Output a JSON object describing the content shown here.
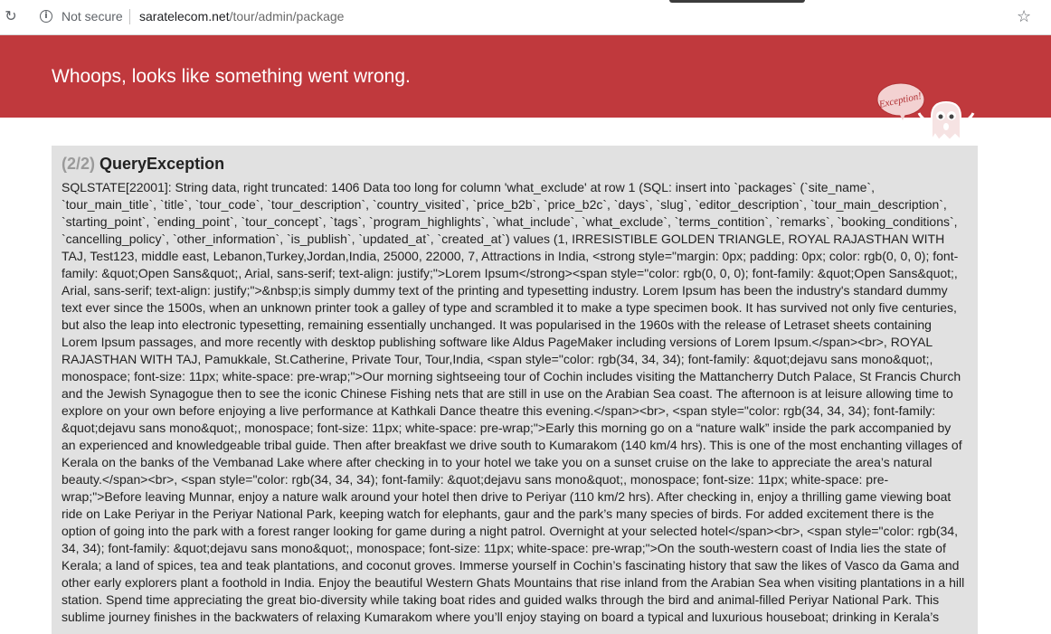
{
  "browser": {
    "security_label": "Not secure",
    "url_host": "saratelecom.net",
    "url_path": "/tour/admin/package"
  },
  "header": {
    "title": "Whoops, looks like something went wrong.",
    "mascot_text": "Exception!",
    "background_color": "#c0393d"
  },
  "exception": {
    "count": "(2/2)",
    "type": "QueryException",
    "message": "SQLSTATE[22001]: String data, right truncated: 1406 Data too long for column 'what_exclude' at row 1 (SQL: insert into `packages` (`site_name`, `tour_main_title`, `title`, `tour_code`, `tour_description`, `country_visited`, `price_b2b`, `price_b2c`, `days`, `slug`, `editor_description`, `tour_main_description`, `starting_point`, `ending_point`, `tour_concept`, `tags`, `program_highlights`, `what_include`, `what_exclude`, `terms_contition`, `remarks`, `booking_conditions`, `cancelling_policy`, `other_information`, `is_publish`, `updated_at`, `created_at`) values (1, IRRESISTIBLE GOLDEN TRIANGLE, ROYAL RAJASTHAN WITH TAJ, Test123, middle east, Lebanon,Turkey,Jordan,India, 25000, 22000, 7, Attractions in India, <strong style=\"margin: 0px; padding: 0px; color: rgb(0, 0, 0); font-family: &quot;Open Sans&quot;, Arial, sans-serif; text-align: justify;\">Lorem Ipsum</strong><span style=\"color: rgb(0, 0, 0); font-family: &quot;Open Sans&quot;, Arial, sans-serif; text-align: justify;\">&nbsp;is simply dummy text of the printing and typesetting industry. Lorem Ipsum has been the industry's standard dummy text ever since the 1500s, when an unknown printer took a galley of type and scrambled it to make a type specimen book. It has survived not only five centuries, but also the leap into electronic typesetting, remaining essentially unchanged. It was popularised in the 1960s with the release of Letraset sheets containing Lorem Ipsum passages, and more recently with desktop publishing software like Aldus PageMaker including versions of Lorem Ipsum.</span><br>, ROYAL RAJASTHAN WITH TAJ, Pamukkale, St.Catherine, Private Tour, Tour,India, <span style=\"color: rgb(34, 34, 34); font-family: &quot;dejavu sans mono&quot;, monospace; font-size: 11px; white-space: pre-wrap;\">Our morning sightseeing tour of Cochin includes visiting the Mattancherry Dutch Palace, St Francis Church and the Jewish Synagogue then to see the iconic Chinese Fishing nets that are still in use on the Arabian Sea coast. The afternoon is at leisure allowing time to explore on your own before enjoying a live performance at Kathkali Dance theatre this evening.</span><br>, <span style=\"color: rgb(34, 34, 34); font-family: &quot;dejavu sans mono&quot;, monospace; font-size: 11px; white-space: pre-wrap;\">Early this morning go on a “nature walk” inside the park accompanied by an experienced and knowledgeable tribal guide. Then after breakfast we drive south to Kumarakom (140 km/4 hrs). This is one of the most enchanting villages of Kerala on the banks of the Vembanad Lake where after checking in to your hotel we take you on a sunset cruise on the lake to appreciate the area’s natural beauty.</span><br>, <span style=\"color: rgb(34, 34, 34); font-family: &quot;dejavu sans mono&quot;, monospace; font-size: 11px; white-space: pre-wrap;\">Before leaving Munnar, enjoy a nature walk around your hotel then drive to Periyar (110 km/2 hrs). After checking in, enjoy a thrilling game viewing boat ride on Lake Periyar in the Periyar National Park, keeping watch for elephants, gaur and the park’s many species of birds. For added excitement there is the option of going into the park with a forest ranger looking for game during a night patrol. Overnight at your selected hotel</span><br>, <span style=\"color: rgb(34, 34, 34); font-family: &quot;dejavu sans mono&quot;, monospace; font-size: 11px; white-space: pre-wrap;\">On the south-western coast of India lies the state of Kerala; a land of spices, tea and teak plantations, and coconut groves. Immerse yourself in Cochin’s fascinating history that saw the likes of Vasco da Gama and other early explorers plant a foothold in India. Enjoy the beautiful Western Ghats Mountains that rise inland from the Arabian Sea when visiting plantations in a hill station. Spend time appreciating the great bio-diversity while taking boat rides and guided walks through the bird and animal-filled Periyar National Park. This sublime journey finishes in the backwaters of relaxing Kumarakom where you’ll enjoy staying on board a typical and luxurious houseboat; drinking in Kerala’s"
  }
}
